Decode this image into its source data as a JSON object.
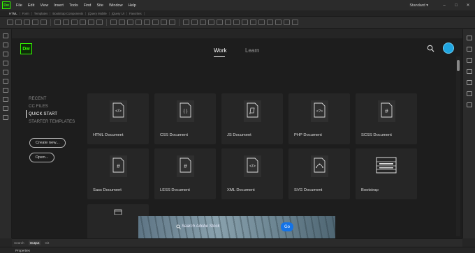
{
  "app": {
    "logo": "Dw"
  },
  "menu": [
    "File",
    "Edit",
    "View",
    "Insert",
    "Tools",
    "Find",
    "Site",
    "Window",
    "Help"
  ],
  "workspace": {
    "label": "Standard",
    "caret": "▾"
  },
  "insert_tabs": [
    "HTML",
    "Form",
    "Templates",
    "Bootstrap Components",
    "jQuery Mobile",
    "jQuery UI",
    "Favorites"
  ],
  "start": {
    "logo": "Dw",
    "tabs": {
      "work": "Work",
      "learn": "Learn"
    },
    "nav": {
      "recent": "RECENT",
      "cc_files": "CC FILES",
      "quick_start": "QUICK START",
      "starter_templates": "STARTER TEMPLATES"
    },
    "buttons": {
      "create_new": "Create new...",
      "open": "Open..."
    },
    "cards": [
      {
        "label": "HTML Document",
        "glyph": "</>"
      },
      {
        "label": "CSS Document",
        "glyph": "{ }"
      },
      {
        "label": "JS Document",
        "glyph": "scroll"
      },
      {
        "label": "PHP Document",
        "glyph": "<?>"
      },
      {
        "label": "SCSS Document",
        "glyph": "#"
      },
      {
        "label": "Sass Document",
        "glyph": "#"
      },
      {
        "label": "LESS Document",
        "glyph": "#"
      },
      {
        "label": "XML Document",
        "glyph": "</>"
      },
      {
        "label": "SVG Document",
        "glyph": "pen"
      },
      {
        "label": "Bootstrap",
        "glyph": "grid"
      }
    ],
    "stock": {
      "placeholder": "Search Adobe Stock",
      "go": "Go"
    }
  },
  "bottom_tabs": {
    "search": "Search",
    "output": "Output",
    "git": "Git"
  },
  "properties": "Properties",
  "colors": {
    "accent": "#35fa00",
    "go": "#1473e6",
    "avatar": "#1fa5e0"
  }
}
